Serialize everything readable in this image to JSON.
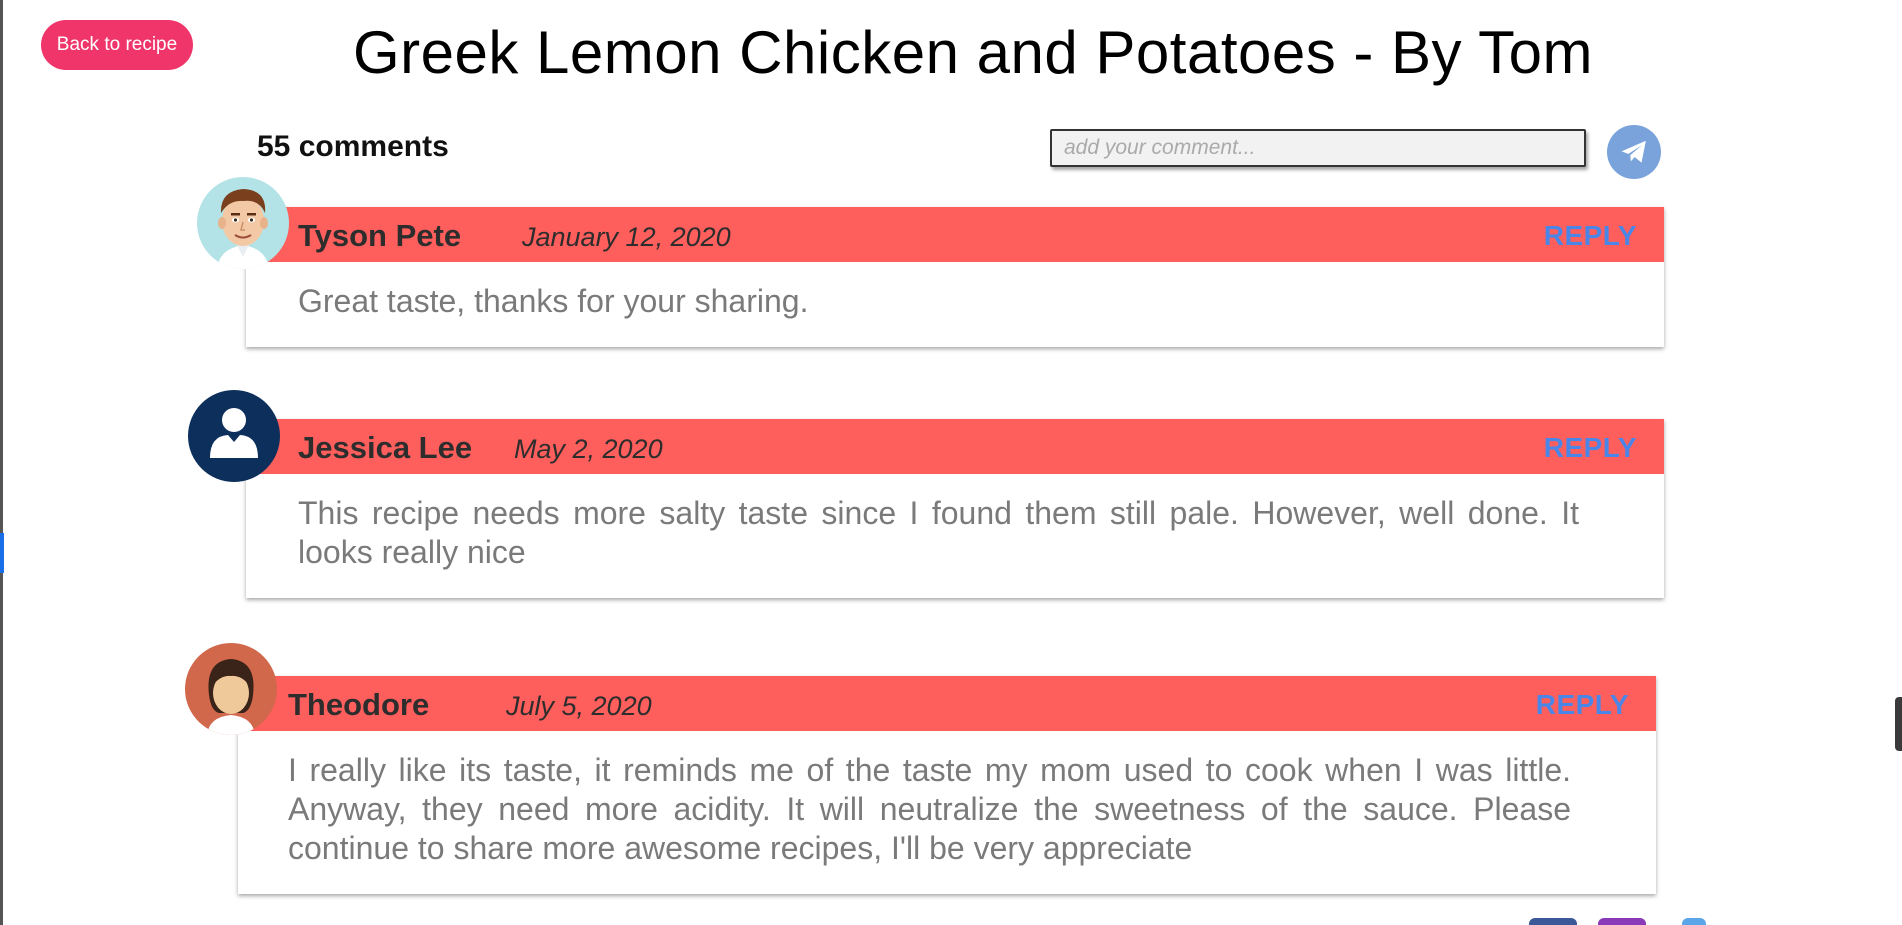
{
  "header": {
    "back_label": "Back to recipe",
    "title": "Greek Lemon Chicken and Potatoes - By Tom"
  },
  "comments_section": {
    "count_label": "55 comments",
    "input_placeholder": "add your comment...",
    "send_icon": "paper-plane-icon"
  },
  "comments": [
    {
      "author": "Tyson Pete",
      "date": "January 12, 2020",
      "reply_label": "REPLY",
      "text": "Great taste, thanks for your sharing.",
      "avatar": "man-cartoon-avatar"
    },
    {
      "author": "Jessica Lee",
      "date": "May 2, 2020",
      "reply_label": "REPLY",
      "text": "This recipe needs more salty taste since I found them still pale. However, well done. It looks really nice",
      "avatar": "user-silhouette-avatar"
    },
    {
      "author": "Theodore",
      "date": "July 5, 2020",
      "reply_label": "REPLY",
      "text": "I really like its taste, it reminds me of the taste my mom used to cook when I was little. Anyway, they need more acidity. It will neutralize the sweetness of the sauce. Please continue to share more awesome recipes, I'll be very appreciate",
      "avatar": "woman-cartoon-avatar"
    }
  ],
  "colors": {
    "accent": "#f0356b",
    "comment_header": "#ff5f5c",
    "reply_link": "#4a86e8",
    "send_button": "#7aa3dc"
  },
  "footer": {
    "social_icons": [
      "facebook-icon",
      "instagram-icon",
      "twitter-icon"
    ]
  }
}
